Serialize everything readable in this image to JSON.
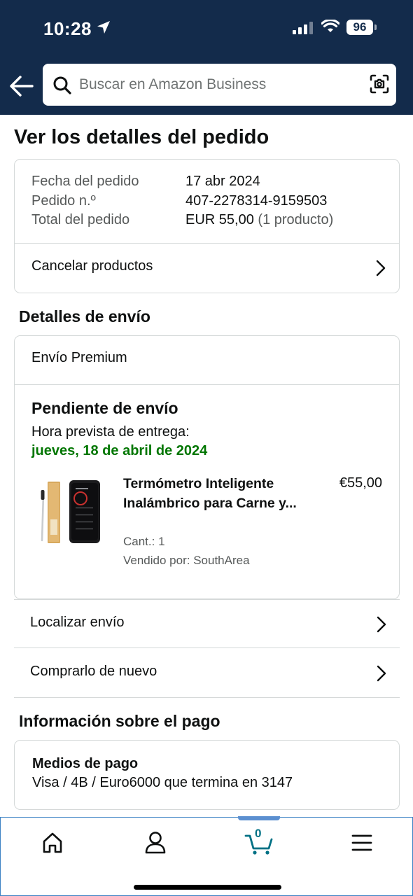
{
  "status_bar": {
    "time": "10:28",
    "battery": "96"
  },
  "search": {
    "placeholder": "Buscar en Amazon Business"
  },
  "page": {
    "title": "Ver los detalles del pedido"
  },
  "order": {
    "date_label": "Fecha del pedido",
    "date_value": "17 abr 2024",
    "number_label": "Pedido n.º",
    "number_value": "407-2278314-9159503",
    "total_label": "Total del pedido",
    "total_value": "EUR 55,00",
    "total_note": "(1 producto)",
    "cancel_label": "Cancelar productos"
  },
  "shipping": {
    "section_title": "Detalles de envío",
    "type": "Envío Premium",
    "status": "Pendiente de envío",
    "eta_label": "Hora prevista de entrega:",
    "eta_value": "jueves, 18 de abril de 2024",
    "product": {
      "title": "Termómetro Inteligente Inalámbrico para Carne y...",
      "price": "€55,00",
      "quantity": "Cant.: 1",
      "seller": "Vendido por: SouthArea"
    },
    "track_label": "Localizar envío",
    "buy_again_label": "Comprarlo de nuevo"
  },
  "payment": {
    "section_title": "Información sobre el pago",
    "method_title": "Medios de pago",
    "method_value": "Visa / 4B / Euro6000  que termina en 3147"
  },
  "bottom_nav": {
    "items": [
      "home-icon",
      "account-icon",
      "cart-icon",
      "menu-icon"
    ],
    "cart_count": "0"
  },
  "colors": {
    "header_bg": "#132B4B",
    "delivery_green": "#007600",
    "cart_teal": "#007185"
  }
}
